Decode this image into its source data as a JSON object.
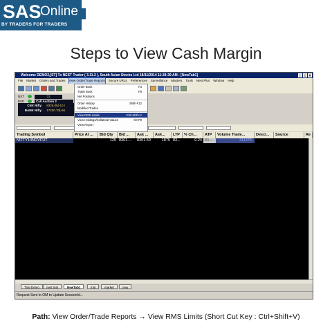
{
  "logo": {
    "brand": "SAS",
    "suffix": "Online",
    "tagline": "BY TRADERS  FOR TRADERS"
  },
  "heading": "Steps to View Cash Margin",
  "window": {
    "title": "Welcome DEMO2,[ST] To NEST Trader ( 3.11.2 ), South Asian Stocks Ltd  18/11/2014  11:34:39 AM - [NewTab1]",
    "menu": [
      "File",
      "Market",
      "Orders and Trades",
      "View Order/Trade Reports",
      "Secure URLs",
      "Preferences",
      "Surveillance",
      "Masters",
      "Tools",
      "Nest Plus",
      "Window",
      "Help"
    ]
  },
  "dropdown": {
    "items": [
      {
        "label": "Order Book",
        "key": "F3"
      },
      {
        "label": "Trade Book",
        "key": "F8"
      },
      {
        "label": "Net Positions",
        "key": ""
      },
      {
        "label": "Order History",
        "key": "Shift+F12"
      },
      {
        "label": "Modified Trades",
        "key": ""
      },
      {
        "label": "View RMS Limits",
        "key": "Ctrl+Shift+V"
      },
      {
        "label": "View Holdings/Collateral Values",
        "key": "Alt+F9"
      },
      {
        "label": "View Report",
        "key": ""
      }
    ]
  },
  "mini_panel": {
    "l1": "NST",
    "l2": "BSD",
    "auction": "Call Auction 2",
    "c1": "31",
    "c2": "0.0"
  },
  "quotes": [
    {
      "name": "CNX Nifty",
      "value": "8326.05(-10.!"
    },
    {
      "name": "BANK Nifty",
      "value": "17200.70(-56."
    }
  ],
  "grid": {
    "headers": [
      "Trading Symbol",
      "Price At ...",
      "Bid Qty",
      "Bid ...",
      "Ask ...",
      "Ask...",
      "LTP",
      "% Ch...",
      "ATP",
      "Volume Trade...",
      "Descr...",
      "Source",
      "Re"
    ],
    "rows": [
      {
        "symbol": "NIFTY14NOVFUT",
        "price": "",
        "bidqty": "125",
        "bid": "8361....",
        "ask": "8361.50",
        "askqty": "1875",
        "ltp": "83...",
        "pct": "-0.24",
        "atp": "83...",
        "vol": "311475",
        "descr": "",
        "source": "",
        "re": ""
      }
    ]
  },
  "tabs": [
    "Trial Demo",
    "nest trial",
    "NewTab1",
    "trial",
    "market",
    "new"
  ],
  "status": "Request Sent to OM to Update SessionId...",
  "footer": {
    "label": "Path:",
    "text": " View Order/Trade Reports → View RMS Limits (Short Cut Key : Ctrl+Shift+V)"
  }
}
